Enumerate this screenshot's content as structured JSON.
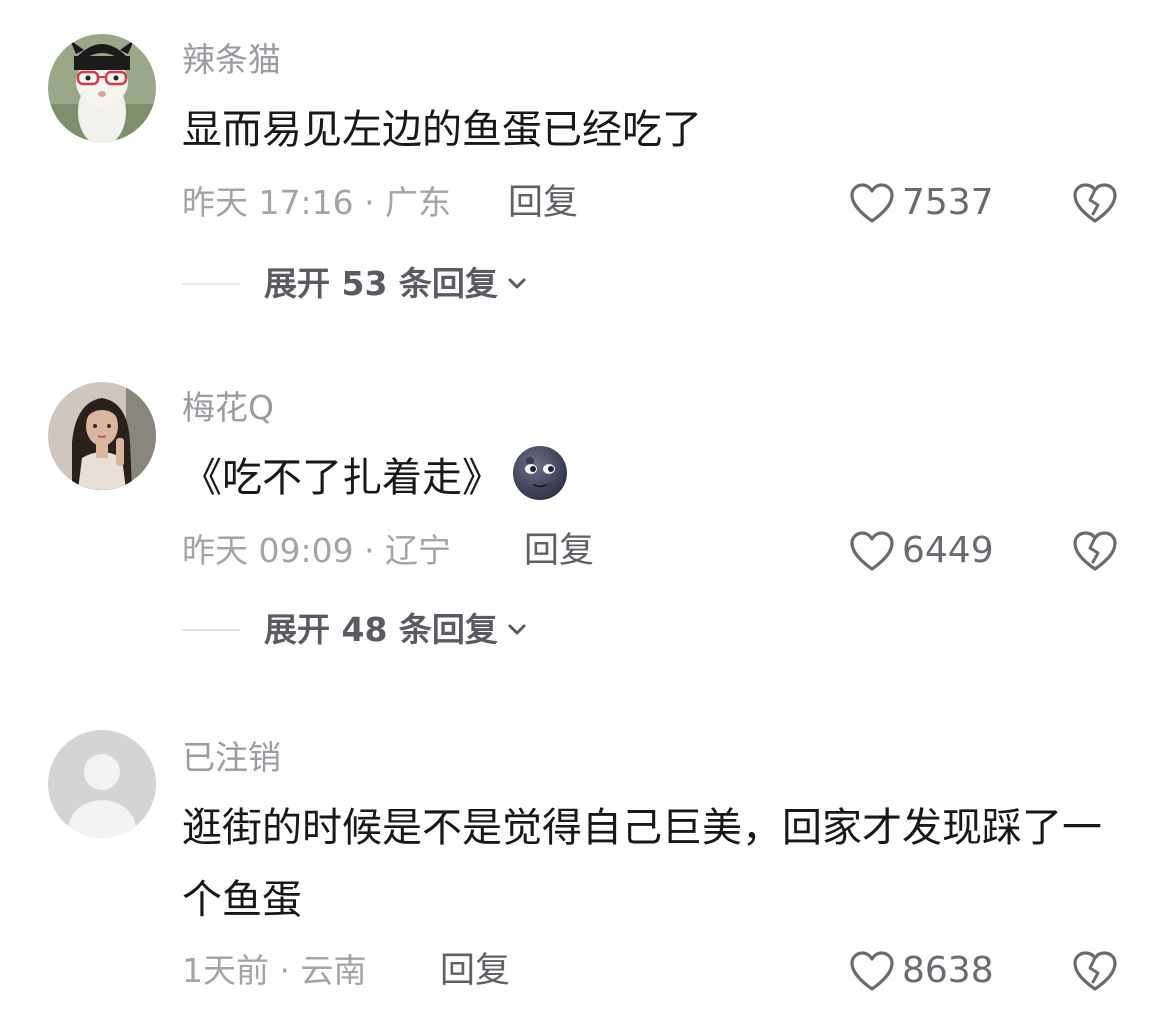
{
  "comments": [
    {
      "username": "辣条猫",
      "text": "显而易见左边的鱼蛋已经吃了",
      "meta": "昨天 17:16 · 广东",
      "reply_label": "回复",
      "likes": "7537",
      "expand_label": "展开 53 条回复",
      "avatar": "glasses-animal-avatar"
    },
    {
      "username": "梅花Q",
      "text": "《吃不了扎着走》",
      "emoji": "new-moon-face-emoji",
      "meta": "昨天 09:09 · 辽宁",
      "reply_label": "回复",
      "likes": "6449",
      "expand_label": "展开 48 条回复",
      "avatar": "woman-portrait-avatar"
    },
    {
      "username": "已注销",
      "text": "逛街的时候是不是觉得自己巨美，回家才发现踩了一个鱼蛋",
      "meta": "1天前 · 云南",
      "reply_label": "回复",
      "likes": "8638",
      "avatar": "default-gray-avatar"
    }
  ],
  "icons": {
    "like": "heart-outline-icon",
    "dislike": "broken-heart-icon",
    "expand": "chevron-down-icon"
  },
  "colors": {
    "username": "#9b9ba1",
    "text": "#17171c",
    "meta": "#a3a3a8",
    "reply": "#5f5f66"
  }
}
